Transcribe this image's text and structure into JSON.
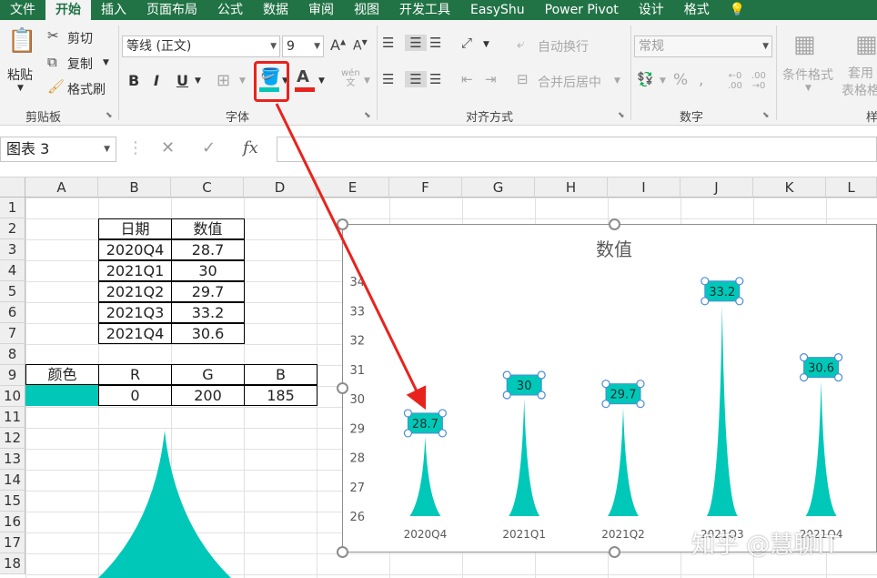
{
  "ribbon": {
    "tabs": [
      "文件",
      "开始",
      "插入",
      "页面布局",
      "公式",
      "数据",
      "审阅",
      "视图",
      "开发工具",
      "EasyShu",
      "Power Pivot",
      "设计",
      "格式",
      "💡"
    ],
    "active_tab": "开始",
    "clipboard": {
      "paste": "粘贴",
      "cut": "剪切",
      "copy": "复制",
      "format_painter": "格式刷",
      "group": "剪贴板"
    },
    "font": {
      "name": "等线 (正文)",
      "size": "9",
      "bold": "B",
      "italic": "I",
      "underline": "U",
      "phonetic": "wén\n文",
      "group": "字体"
    },
    "alignment": {
      "wrap": "自动换行",
      "merge": "合并后居中",
      "group": "对齐方式"
    },
    "number": {
      "format": "常规",
      "percent": "%",
      "group": "数字"
    },
    "styles": {
      "conditional": "条件格式",
      "table": "套用\n表格格",
      "group": "样"
    },
    "fill_color": "#00c8b9",
    "font_color": "#e8231d"
  },
  "formula_bar": {
    "name_box": "图表 3",
    "cancel": "✕",
    "enter": "✓",
    "fx": "fx",
    "value": ""
  },
  "sheet": {
    "columns": [
      "A",
      "B",
      "C",
      "D",
      "E",
      "F",
      "G",
      "H",
      "I",
      "J",
      "K",
      "L"
    ],
    "rows": [
      "1",
      "2",
      "3",
      "4",
      "5",
      "6",
      "7",
      "8",
      "9",
      "10",
      "11",
      "12",
      "13",
      "14",
      "15",
      "16",
      "17",
      "18"
    ],
    "table_header": [
      "日期",
      "数值"
    ],
    "table_rows": [
      [
        "2020Q4",
        "28.7"
      ],
      [
        "2021Q1",
        "30"
      ],
      [
        "2021Q2",
        "29.7"
      ],
      [
        "2021Q3",
        "33.2"
      ],
      [
        "2021Q4",
        "30.6"
      ]
    ],
    "color_header": [
      "颜色",
      "R",
      "G",
      "B"
    ],
    "color_values": [
      "",
      "0",
      "200",
      "185"
    ],
    "swatch_color": "#00c8b9"
  },
  "chart_data": {
    "type": "bar",
    "title": "数值",
    "categories": [
      "2020Q4",
      "2021Q1",
      "2021Q2",
      "2021Q3",
      "2021Q4"
    ],
    "values": [
      28.7,
      30,
      29.7,
      33.2,
      30.6
    ],
    "data_labels": [
      "28.7",
      "30",
      "29.7",
      "33.2",
      "30.6"
    ],
    "ylim": [
      26,
      34
    ],
    "yticks": [
      26,
      27,
      28,
      29,
      30,
      31,
      32,
      33,
      34
    ],
    "grid": false,
    "bar_shape": "spike",
    "bar_color": "#00c8b9"
  },
  "watermark": "知乎 @慧聊IT",
  "annotation_color": "#e8231d"
}
